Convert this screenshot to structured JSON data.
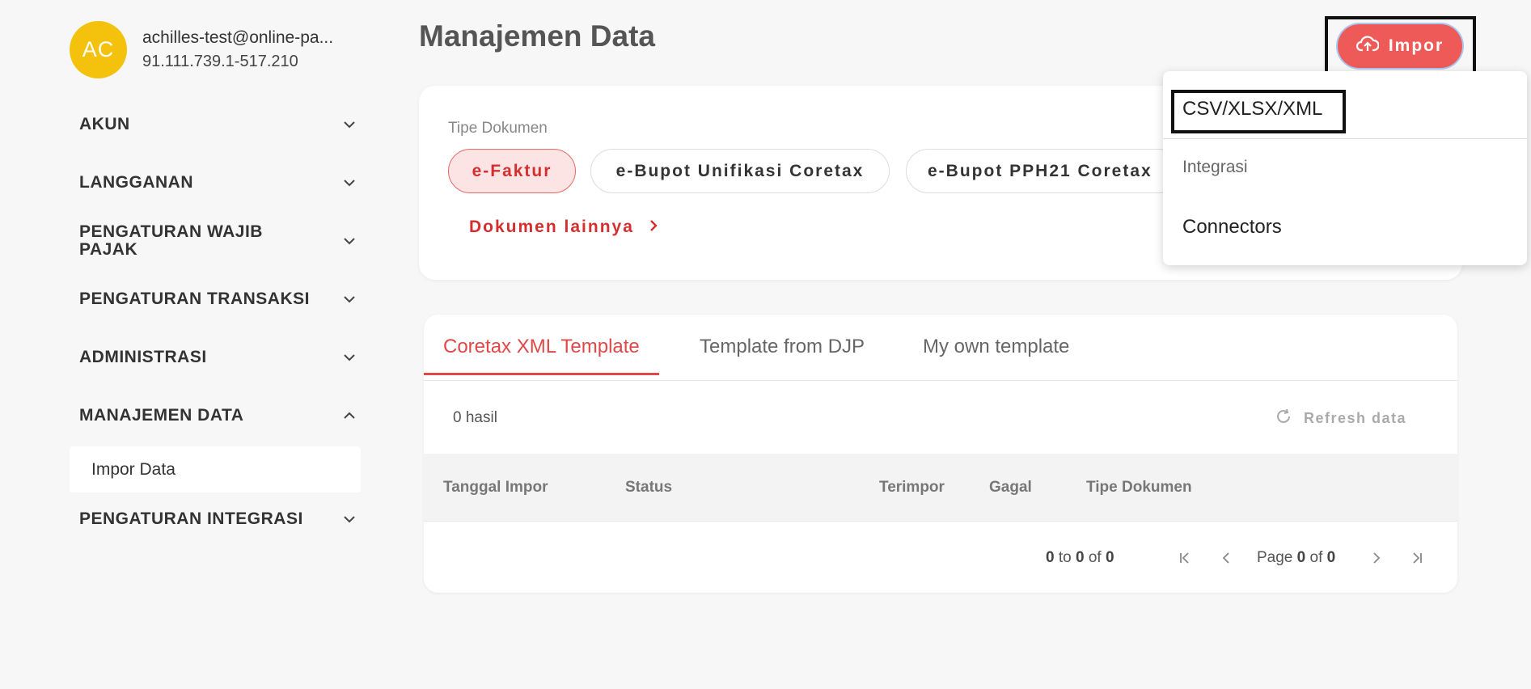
{
  "user": {
    "initials": "AC",
    "email": "achilles-test@online-pa...",
    "npwp": "91.111.739.1-517.210"
  },
  "sidebar": {
    "items": [
      {
        "label": "AKUN",
        "expanded": false
      },
      {
        "label": "LANGGANAN",
        "expanded": false
      },
      {
        "label": "PENGATURAN WAJIB PAJAK",
        "expanded": false
      },
      {
        "label": "PENGATURAN TRANSAKSI",
        "expanded": false
      },
      {
        "label": "ADMINISTRASI",
        "expanded": false
      },
      {
        "label": "MANAJEMEN DATA",
        "expanded": true
      },
      {
        "label": "PENGATURAN INTEGRASI",
        "expanded": false
      }
    ],
    "subitem": "Impor Data"
  },
  "page": {
    "title": "Manajemen Data"
  },
  "doc_types": {
    "label": "Tipe Dokumen",
    "chips": [
      "e-Faktur",
      "e-Bupot Unifikasi Coretax",
      "e-Bupot PPH21 Coretax"
    ],
    "active": "e-Faktur",
    "more": "Dokumen lainnya"
  },
  "impor_button": {
    "label": "Impor",
    "icon": "cloud-upload-icon"
  },
  "dropdown": {
    "csv": "CSV/XLSX/XML",
    "integrasi": "Integrasi",
    "connectors": "Connectors"
  },
  "tabs": [
    "Coretax XML Template",
    "Template from DJP",
    "My own template"
  ],
  "table": {
    "result_count": "0 hasil",
    "refresh": "Refresh data",
    "headers": [
      "Tanggal Impor",
      "Status",
      "Terimpor",
      "Gagal",
      "Tipe Dokumen"
    ],
    "rows": []
  },
  "pager": {
    "range_start": "0",
    "range_end": "0",
    "total": "0",
    "page": "0",
    "pages": "0",
    "to_word": "to",
    "of_word": "of",
    "page_word": "Page"
  },
  "colors": {
    "accent": "#e04848",
    "avatar": "#f4c20d",
    "button": "#ee5a58"
  }
}
